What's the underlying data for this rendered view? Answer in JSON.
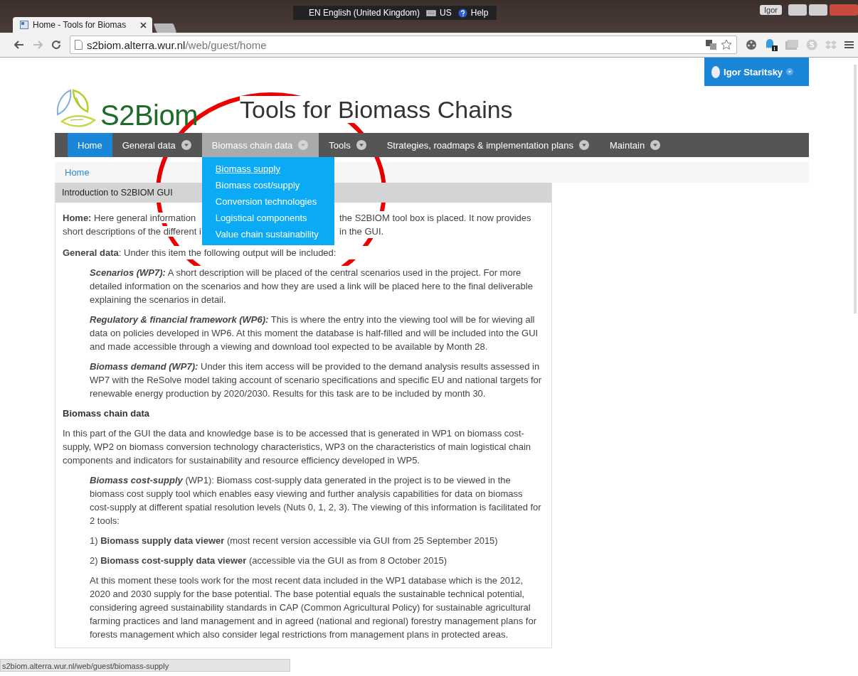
{
  "window": {
    "user": "Igor"
  },
  "language_bar": {
    "language": "EN English (United Kingdom)",
    "keyboard": "US",
    "help": "Help"
  },
  "tabs": [
    {
      "title": "Home - Tools for Biomas",
      "selected": true
    }
  ],
  "address_bar": {
    "host": "s2biom.alterra.wur.nl",
    "path": "/web/guest/home"
  },
  "user_menu": {
    "name": "Igor Staritsky"
  },
  "header": {
    "logo": "S2Biom",
    "title": "Tools for Biomass Chains"
  },
  "nav": [
    {
      "label": "Home",
      "selected": true,
      "open": false,
      "dropdown": false
    },
    {
      "label": "General data",
      "selected": false,
      "open": false,
      "dropdown": true
    },
    {
      "label": "Biomass chain data",
      "selected": false,
      "open": true,
      "dropdown": true
    },
    {
      "label": "Tools",
      "selected": false,
      "open": false,
      "dropdown": true
    },
    {
      "label": "Strategies, roadmaps & implementation plans",
      "selected": false,
      "open": false,
      "dropdown": true
    },
    {
      "label": "Maintain",
      "selected": false,
      "open": false,
      "dropdown": true
    }
  ],
  "dropdown": [
    {
      "label": "Biomass supply",
      "hovered": true
    },
    {
      "label": "Biomass cost/supply",
      "hovered": false
    },
    {
      "label": "Conversion technologies",
      "hovered": false
    },
    {
      "label": "Logistical components",
      "hovered": false
    },
    {
      "label": "Value chain sustainability",
      "hovered": false
    }
  ],
  "breadcrumb": [
    "Home"
  ],
  "panel": {
    "title": "Introduction to S2BIOM GUI",
    "blocks": [
      {
        "kind": "split",
        "lines": [
          {
            "left": "**Home:** Here general information",
            "right": "the S2BIOM tool box is placed. It now provides"
          },
          {
            "left": "short descriptions of the different i",
            "right": "in the GUI."
          }
        ]
      },
      {
        "kind": "para",
        "text": "**General data**: Under this item the following output will be included:"
      },
      {
        "kind": "indent",
        "lead": "Scenarios (WP7):",
        "text": " A short description will be placed of the central scenarios used in the project. For more detailed information on the scenarios and how they are used a link will be placed here to the final deliverable explaining the scenarios in detail."
      },
      {
        "kind": "indent",
        "lead": "Regulatory & financial framework (WP6):",
        "text": " This is where the entry into the viewing tool will be for wieving all data on policies developed in WP6. At this moment the database is half-filled and will be included into the GUI and made accessible through a viewing and download tool expected to be available by Month 28."
      },
      {
        "kind": "indent",
        "lead": "Biomass demand (WP7):",
        "text": " Under this item access will be provided to the demand analysis results assessed in WP7 with the ReSolve model taking account of scenario specifications and specific EU and national targets for renewable energy production by 2020/2030. Results for this task are to be included by month 30."
      },
      {
        "kind": "heading",
        "text": "Biomass chain data"
      },
      {
        "kind": "para",
        "text": "In this part of the GUI the data and knowledge base is to be accessed that is generated in WP1 on biomass cost-supply, WP2 on biomass conversion technology characteristics, WP3 on the characteristics of main logistical chain components and indicators for sustainability and resource efficiency developed in WP5."
      },
      {
        "kind": "indent",
        "lead": "Biomass cost-supply",
        "text": " (WP1): Biomass cost-supply data generated in the project is to be viewed in the biomass cost supply tool which enables easy viewing and further analysis capabilities for data on biomass cost-supply at different spatial resolution levels (Nuts 0, 1, 2, 3). The viewing of this information is facilitated for 2 tools:"
      },
      {
        "kind": "indent",
        "text": "1) **Biomass supply data viewer** (most recent version accessible via GUI from 25 September 2015)"
      },
      {
        "kind": "indent",
        "text": "2) **Biomass cost-supply data viewer** (accessible via the GUI as from 8 October 2015)"
      },
      {
        "kind": "indent",
        "text": "At this moment these tools work for the most recent data included in the WP1 database which is the 2012, 2020 and 2030 supply for the base potential. The base potential equals the sustainable technical potential, considering agreed sustainability standards in CAP (Common Agricultural Policy) for sustainable agricultural farming practices and land management and  in agreed (national and regional) forestry management plans for forests management which also consider legal restrictions from management plans in protected areas."
      }
    ]
  },
  "status_bar": {
    "url": "s2biom.alterra.wur.nl/web/guest/biomass-supply"
  }
}
